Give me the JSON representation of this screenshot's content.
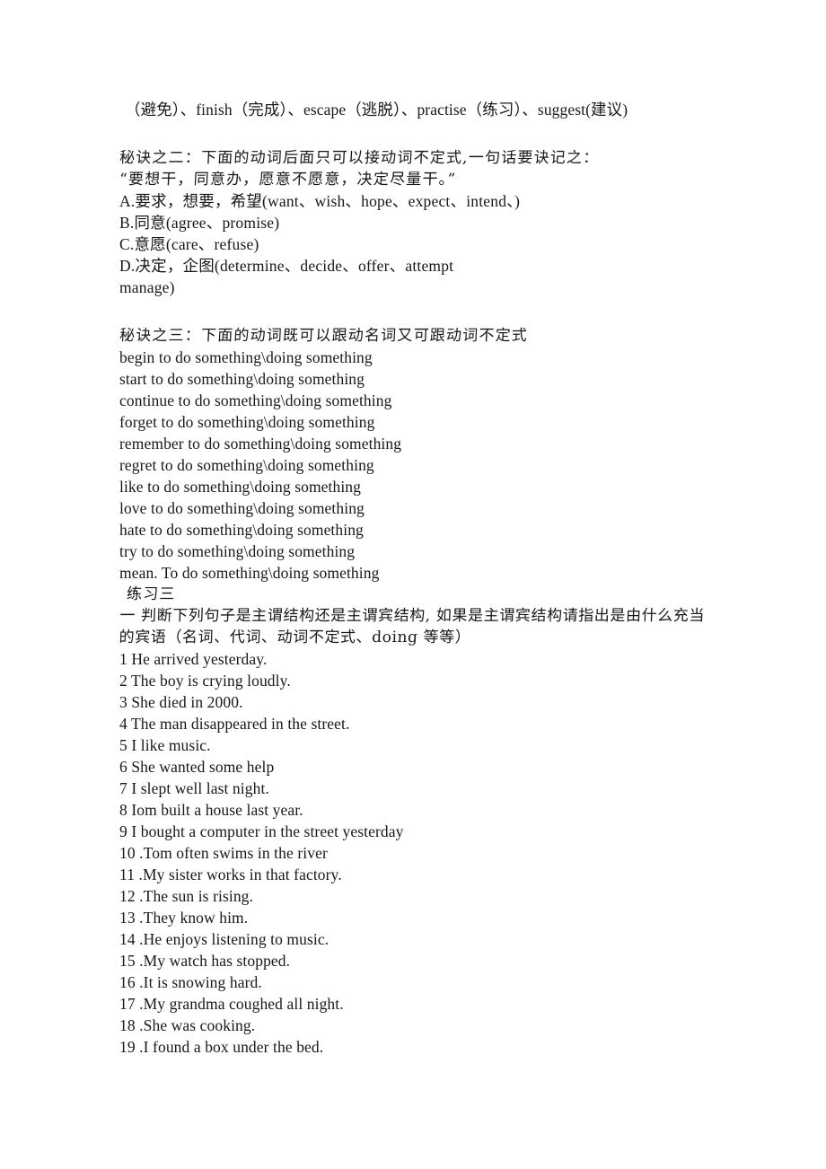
{
  "document": {
    "page_background": "#ffffff",
    "text_color": "#181818"
  },
  "section_one_tail": {
    "line": "（避免）、finish（完成）、escape（逃脱）、practise（练习）、suggest(建议)"
  },
  "section_two": {
    "heading": "秘诀之二：下面的动词后面只可以接动词不定式,一句话要诀记之：",
    "mnemonic": "“要想干，同意办，愿意不愿意，决定尽量干。”",
    "items": [
      "A.要求，想要，希望(want、wish、hope、expect、intend、)",
      "B.同意(agree、promise)",
      "C.意愿(care、refuse)",
      "D.决定，企图(determine、decide、offer、attempt",
      "manage)"
    ]
  },
  "section_three": {
    "heading": "秘诀之三：下面的动词既可以跟动名词又可跟动词不定式",
    "patterns": [
      "begin to do something\\doing something",
      "start to do something\\doing something",
      "continue to do something\\doing something",
      "forget to do something\\doing something",
      "remember to do something\\doing something",
      "regret to do something\\doing something",
      "like to do something\\doing something",
      "love to do something\\doing something",
      "hate to do something\\doing something",
      "try to do something\\doing something",
      "mean. To do something\\doing something"
    ]
  },
  "exercise": {
    "label": "练习三",
    "instruction": "一  判断下列句子是主谓结构还是主谓宾结构, 如果是主谓宾结构请指出是由什么充当的宾语（名词、代词、动词不定式、doing  等等）",
    "sentences": [
      "1 He arrived yesterday.",
      "2 The boy is crying loudly.",
      "3 She died in 2000.",
      "4 The man disappeared in the street.",
      "5 I like music.",
      "6 She wanted some help",
      "7 I slept well last night.",
      "8 Iom built a house last year.",
      "9 I bought a computer in the street yesterday",
      "10 .Tom often swims in the river",
      "11 .My sister works in that factory.",
      "12 .The sun is rising.",
      "13 .They know him.",
      "14 .He enjoys listening to music.",
      "15 .My watch has stopped.",
      "16 .It is snowing hard.",
      "17 .My grandma coughed all night.",
      "18 .She was cooking.",
      "19 .I found a box under the bed."
    ]
  }
}
